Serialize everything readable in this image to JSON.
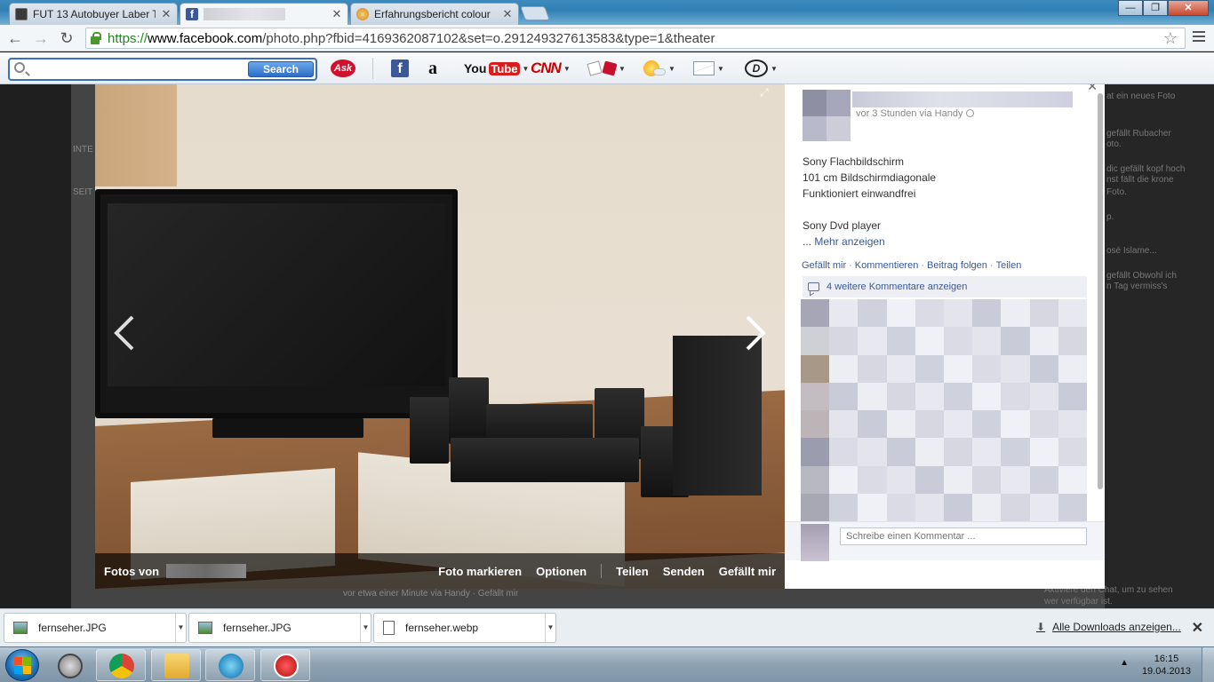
{
  "tabs": [
    {
      "title": "FUT 13 Autobuyer Laber T",
      "close": "✕"
    },
    {
      "title": "",
      "close": "✕"
    },
    {
      "title": "Erfahrungsbericht colour",
      "close": "✕"
    }
  ],
  "window": {
    "minimize": "—",
    "maximize": "❐",
    "close": "✕"
  },
  "address": {
    "scheme": "https://",
    "host": "www.facebook.com",
    "path": "/photo.php?fbid=4169362087102&set=o.291249327613583&type=1&theater"
  },
  "nav": {
    "back": "←",
    "forward": "→",
    "reload": "↻",
    "star": "☆"
  },
  "asktoolbar": {
    "search_label": "Search",
    "search_value": "",
    "icons": [
      "ask-icon",
      "facebook-icon",
      "amazon-icon",
      "youtube-icon",
      "cnn-icon",
      "games-dice-icon",
      "weather-icon",
      "mail-icon",
      "dictionary-icon"
    ],
    "ask": "Ask",
    "facebook": "f",
    "amazon": "a",
    "youtube_you": "You",
    "youtube_tube": "Tube",
    "cnn": "CNN",
    "dictionary": "D"
  },
  "photo": {
    "bar": {
      "fotos_von": "Fotos von",
      "tag": "Foto markieren",
      "options": "Optionen",
      "share": "Teilen",
      "send": "Senden",
      "like": "Gefällt mir"
    }
  },
  "post": {
    "time": "vor 3 Stunden via Handy",
    "text": "Sony Flachbildschirm\n101 cm Bildschirmdiagonale\nFunktioniert einwandfrei\n\nSony Dvd player",
    "more_prefix": "... ",
    "more": "Mehr anzeigen",
    "actions": [
      "Gefällt mir",
      "Kommentieren",
      "Beitrag folgen",
      "Teilen"
    ],
    "comments_link": "4 weitere Kommentare anzeigen",
    "comment_placeholder": "Schreibe einen Kommentar ..."
  },
  "background": {
    "left_labels": [
      "INTE",
      "SEIT"
    ],
    "right_labels": [
      "at ein neues Foto",
      "gefällt Rubacher",
      "oto.",
      "dic gefällt kopf hoch",
      "nst fällt die krone",
      "Foto.",
      "p.",
      "osé Islame...",
      "gefällt Obwohl ich",
      "n Tag vermiss's"
    ],
    "bottom_line": "vor etwa einer Minute via Handy · Gefällt mir",
    "chat_line1": "Aktiviere den Chat, um zu sehen",
    "chat_line2": "wer verfügbar ist."
  },
  "downloads": {
    "items": [
      {
        "name": "fernseher.JPG",
        "type": "image"
      },
      {
        "name": "fernseher.JPG",
        "type": "image"
      },
      {
        "name": "fernseher.webp",
        "type": "doc"
      }
    ],
    "show_all": "Alle Downloads anzeigen...",
    "close": "✕"
  },
  "taskbar": {
    "time": "16:15",
    "date": "19.04.2013",
    "tray_arrow": "▲",
    "apps": [
      "sync-icon",
      "chrome-icon",
      "explorer-icon",
      "people-icon",
      "fut13-autobuyer-icon"
    ]
  }
}
